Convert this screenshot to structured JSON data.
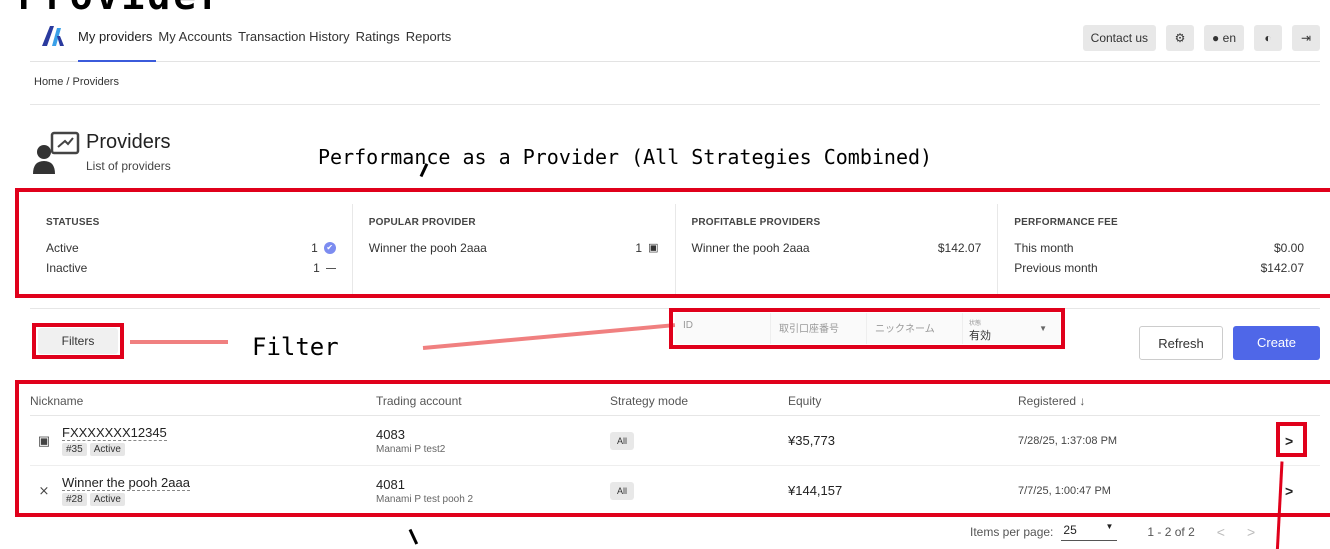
{
  "doc_title": "Provider",
  "nav": {
    "items": [
      "My providers",
      "My Accounts",
      "Transaction History",
      "Ratings",
      "Reports"
    ],
    "contact": "Contact us",
    "lang": "en"
  },
  "breadcrumb": "Home / Providers",
  "page": {
    "title": "Providers",
    "subtitle": "List of providers"
  },
  "annotations": {
    "performance": "Performance as a Provider (All Strategies Combined)",
    "filter": "Filter"
  },
  "stats": {
    "statuses": {
      "head": "STATUSES",
      "rows": [
        {
          "label": "Active",
          "value": "1"
        },
        {
          "label": "Inactive",
          "value": "1"
        }
      ]
    },
    "popular": {
      "head": "POPULAR PROVIDER",
      "name": "Winner the pooh 2aaa",
      "value": "1"
    },
    "profitable": {
      "head": "PROFITABLE PROVIDERS",
      "name": "Winner the pooh 2aaa",
      "value": "$142.07"
    },
    "fee": {
      "head": "PERFORMANCE FEE",
      "rows": [
        {
          "label": "This month",
          "value": "$0.00"
        },
        {
          "label": "Previous month",
          "value": "$142.07"
        }
      ]
    }
  },
  "filters": {
    "button": "Filters",
    "id_placeholder": "ID",
    "account_placeholder": "取引口座番号",
    "nickname_placeholder": "ニックネーム",
    "status_label": "状態",
    "status_value": "有効"
  },
  "actions": {
    "refresh": "Refresh",
    "create": "Create"
  },
  "table": {
    "headers": [
      "Nickname",
      "Trading account",
      "Strategy mode",
      "Equity",
      "Registered"
    ],
    "rows": [
      {
        "nickname": "FXXXXXXX12345",
        "id": "#35",
        "status": "Active",
        "account": "4083",
        "account_name": "Manami P test2",
        "mode": "All",
        "equity": "¥35,773",
        "registered": "7/28/25, 1:37:08 PM"
      },
      {
        "nickname": "Winner the pooh 2aaa",
        "id": "#28",
        "status": "Active",
        "account": "4081",
        "account_name": "Manami P test pooh 2",
        "mode": "All",
        "equity": "¥144,157",
        "registered": "7/7/25, 1:00:47 PM"
      }
    ]
  },
  "pager": {
    "label": "Items per page:",
    "per_page": "25",
    "range": "1 - 2 of 2"
  },
  "icons": {
    "settings": "gear-icon",
    "language": "globe-icon",
    "theme": "contrast-icon",
    "logout": "logout-icon",
    "provider": "provider-icon",
    "disabled": "provider-off-icon",
    "next": "chevron-right-icon",
    "prev": "chevron-left-icon"
  },
  "colors": {
    "accent": "#4f67e8",
    "annotation_red": "#e0001b"
  }
}
